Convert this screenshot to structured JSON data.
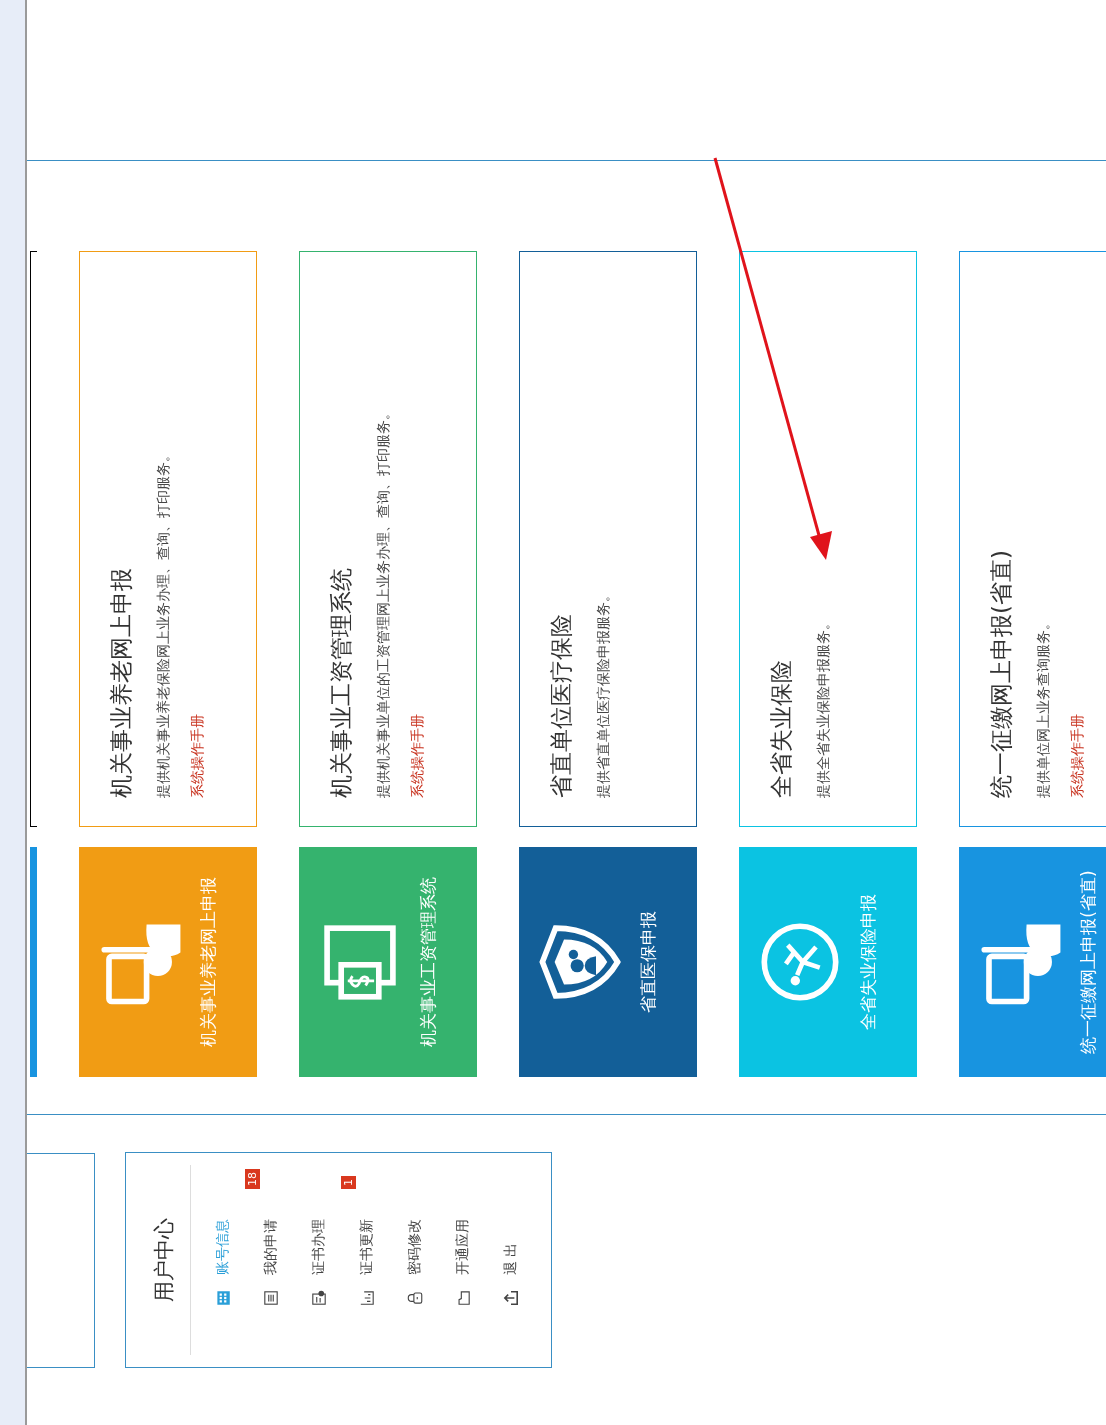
{
  "user_center": {
    "title": "用户中心",
    "items": [
      {
        "label": "账号信息",
        "selected": true,
        "kind": "building"
      },
      {
        "label": "我的申请",
        "selected": false,
        "kind": "list",
        "badge": "18"
      },
      {
        "label": "证书办理",
        "selected": false,
        "kind": "certificate"
      },
      {
        "label": "证书更新",
        "selected": false,
        "kind": "chart",
        "badge": "1"
      },
      {
        "label": "密码修改",
        "selected": false,
        "kind": "lock"
      },
      {
        "label": "开通应用",
        "selected": false,
        "kind": "folder"
      },
      {
        "label": "退 出",
        "selected": false,
        "kind": "exit"
      }
    ]
  },
  "services": [
    {
      "kind": "pension",
      "color": "#f19c14",
      "tile_label": "机关事业养老网上申报",
      "title": "机关事业养老网上申报",
      "description": "提供机关事业养老保险网上业务办理、查询、打印服务。",
      "manual_link": "系统操作手册"
    },
    {
      "kind": "payroll",
      "color": "#35b36e",
      "tile_label": "机关事业工资管理系统",
      "title": "机关事业工资管理系统",
      "description": "提供机关事业单位的工资管理网上业务办理、查询、打印服务。",
      "manual_link": "系统操作手册"
    },
    {
      "kind": "medical",
      "color": "#135f98",
      "tile_label": "省直医保申报",
      "title": "省直单位医疗保险",
      "description": "提供省直单位医疗保险申报服务。"
    },
    {
      "kind": "unemployment",
      "color": "#0bc3e2",
      "tile_label": "全省失业保险申报",
      "title": "全省失业保险",
      "description": "提供全省失业保险申报服务。"
    },
    {
      "kind": "levy",
      "color": "#1894e0",
      "tile_label": "统一征缴网上申报(省直)",
      "title": "统一征缴网上申报(省直)",
      "description": "提供单位网上业务查询服务。",
      "manual_link": "系统操作手册"
    }
  ]
}
